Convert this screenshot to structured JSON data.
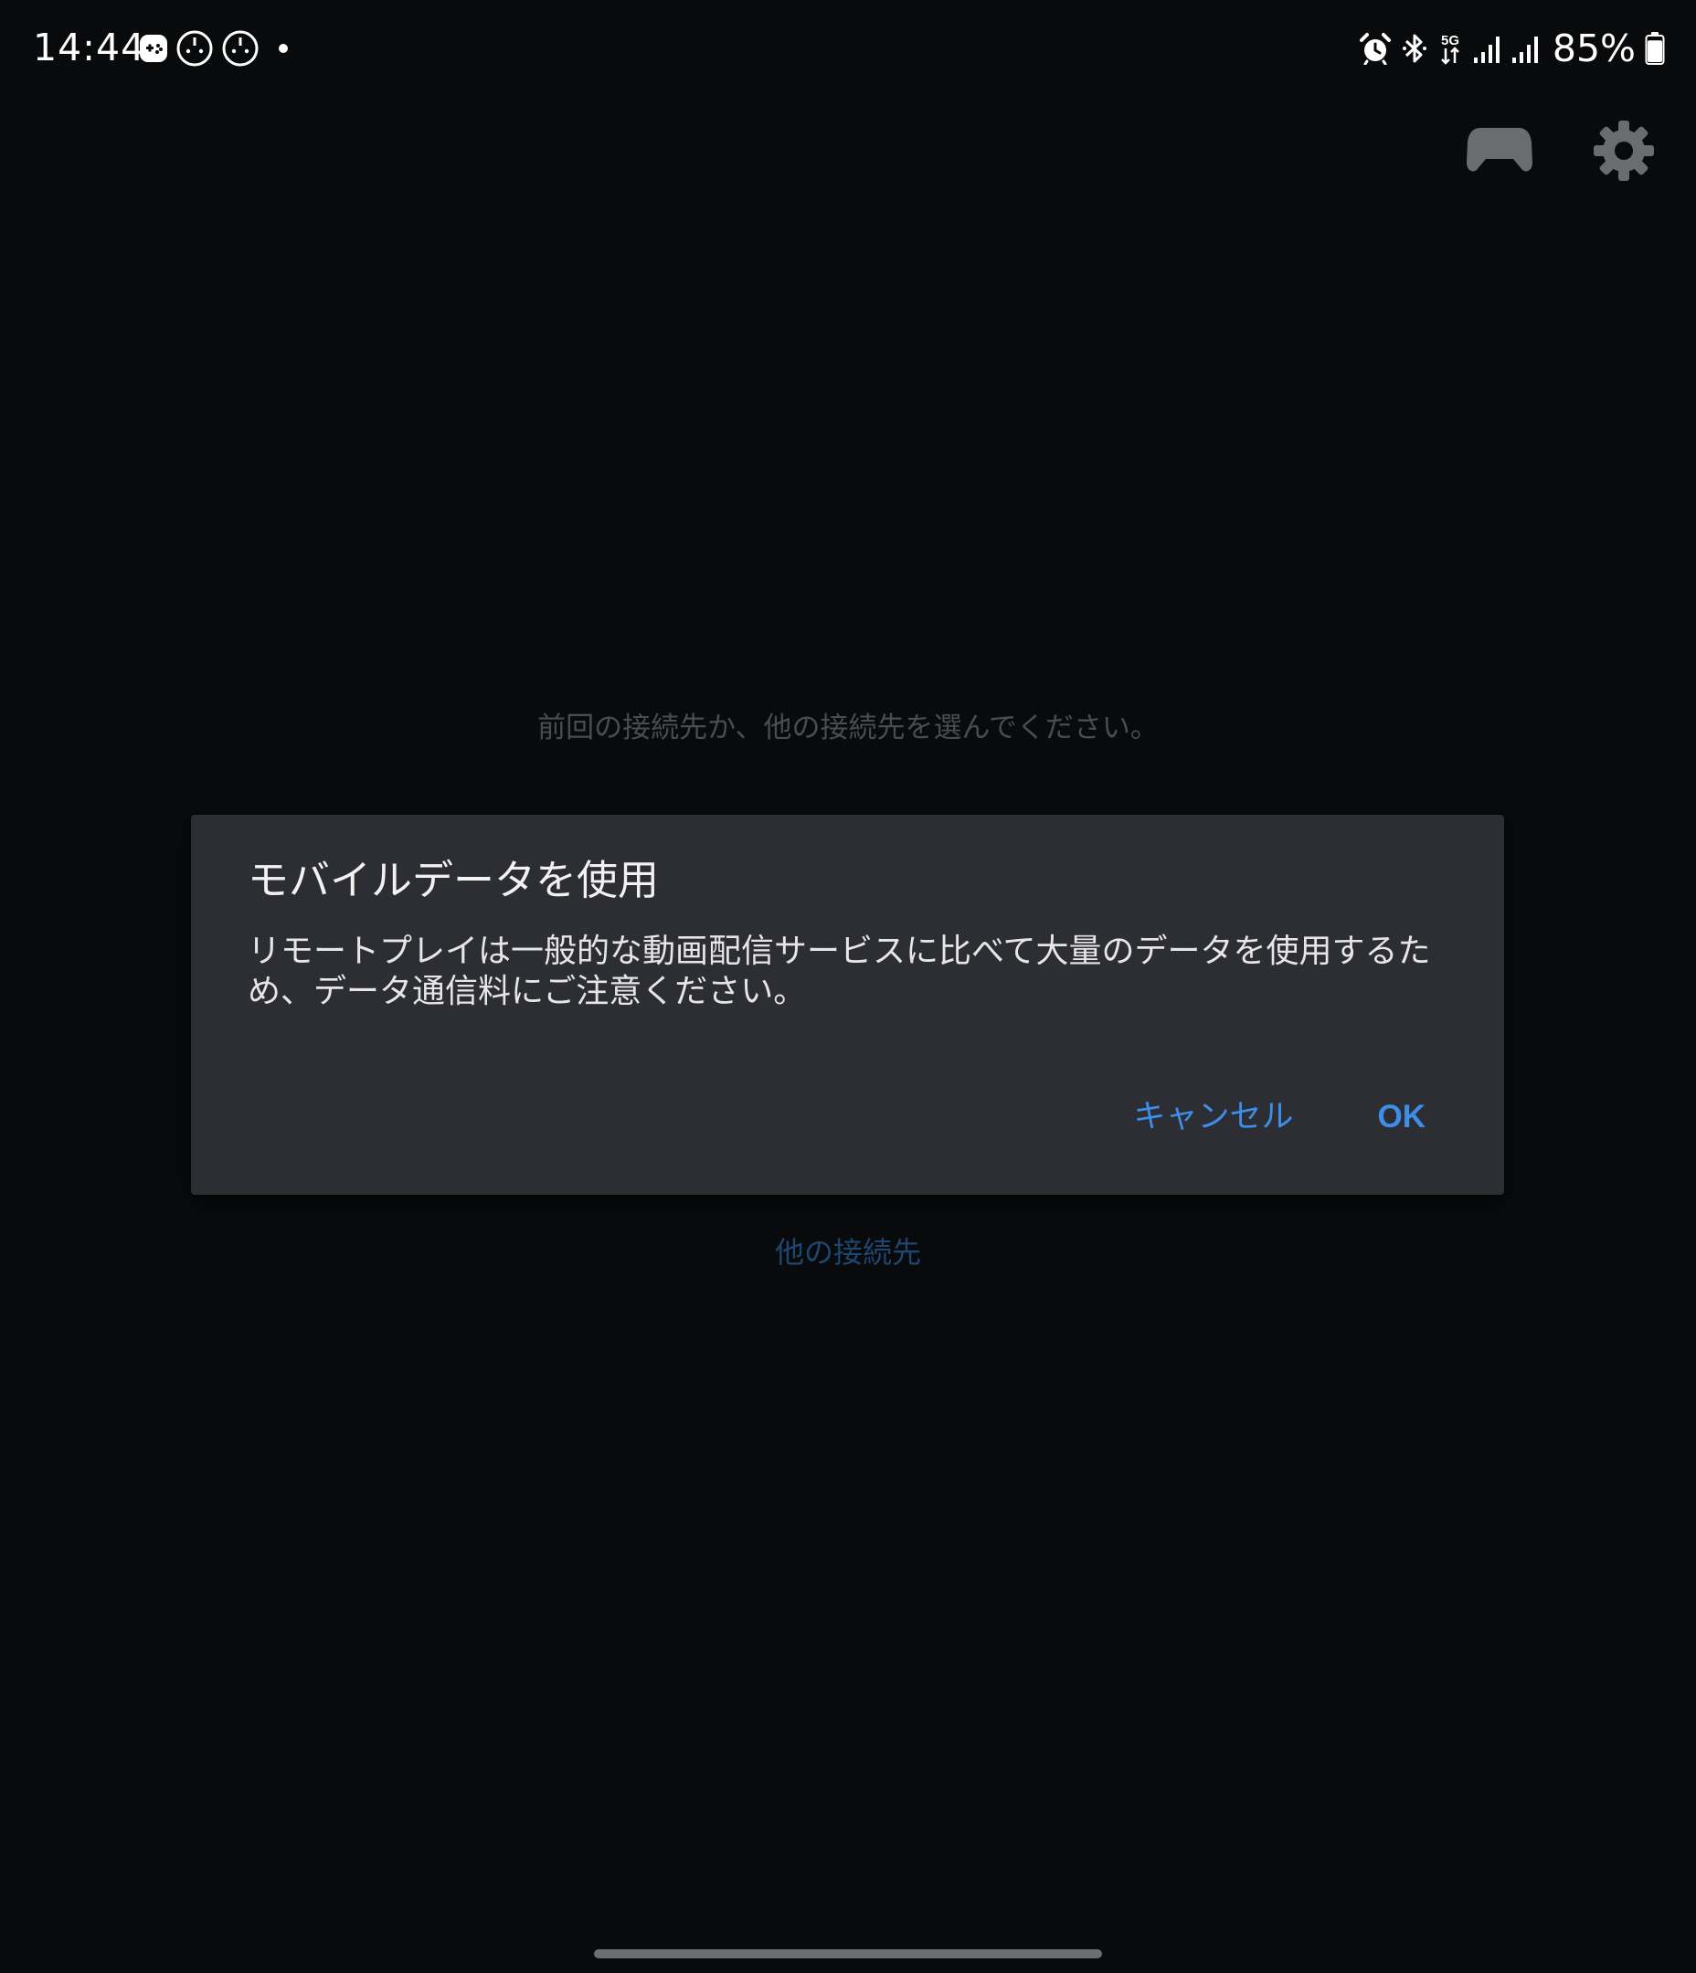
{
  "status_bar": {
    "time": "14:44",
    "battery_percent": "85%",
    "battery_level": 0.85,
    "notification_icons": [
      "game-launcher-icon",
      "remote-play-icon",
      "remote-play-icon",
      "more-notifications-dot-icon"
    ],
    "system_icons": [
      "alarm-icon",
      "bluetooth-icon",
      "5g-data-icon",
      "signal-icon",
      "signal-icon",
      "battery-icon"
    ]
  },
  "toolbar": {
    "icons": [
      "controller-icon",
      "settings-gear-icon"
    ]
  },
  "main": {
    "prompt": "前回の接続先か、他の接続先を選んでください。",
    "other_destination_link": "他の接続先"
  },
  "dialog": {
    "title": "モバイルデータを使用",
    "message": "リモートプレイは一般的な動画配信サービスに比べて大量のデータを使用するため、データ通信料にご注意ください。",
    "cancel_label": "キャンセル",
    "ok_label": "OK"
  },
  "colors": {
    "background": "#080a0b",
    "dialog_background": "#2d2e33",
    "accent": "#3d8ee8",
    "dim_link": "#1f4670",
    "dim_text": "#4a4c50",
    "toolbar_icon": "#6b6c6e"
  }
}
